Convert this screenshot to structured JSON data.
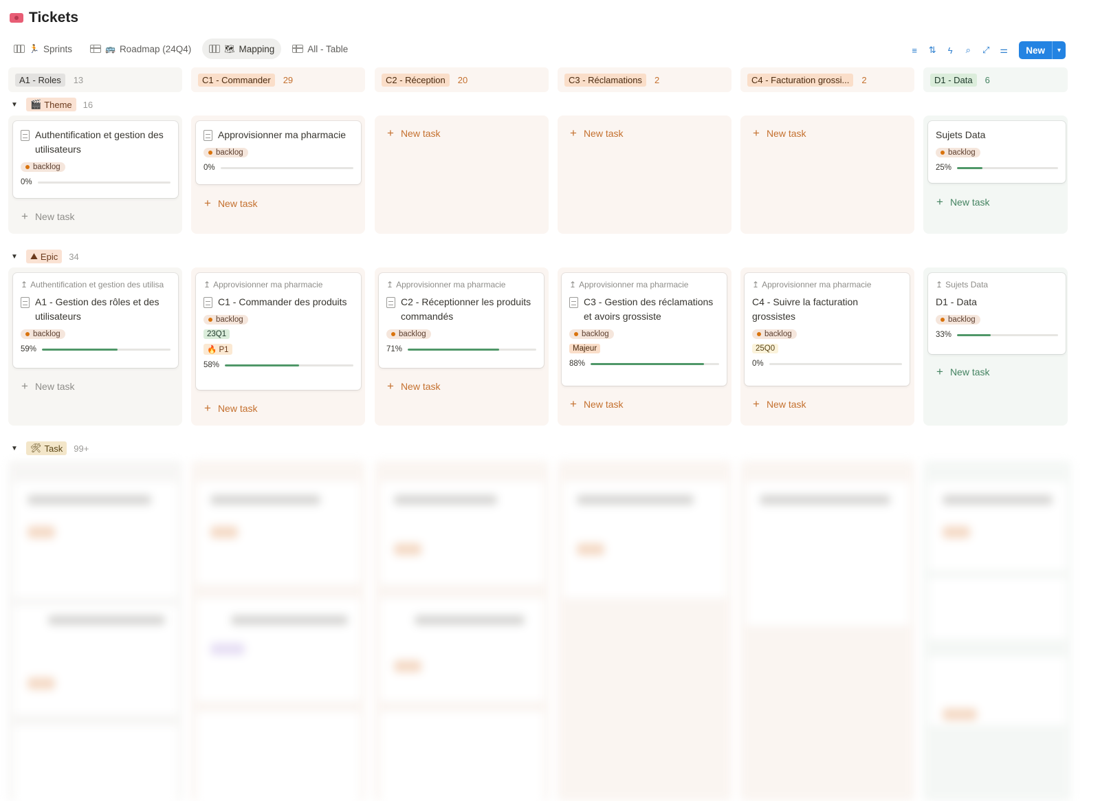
{
  "page": {
    "title": "Tickets",
    "icon": "ticket-icon"
  },
  "tabs": [
    {
      "label": "Sprints",
      "icon": "board-icon",
      "emoji": "🏃"
    },
    {
      "label": "Roadmap (24Q4)",
      "icon": "table-icon",
      "emoji": "🚌"
    },
    {
      "label": "Mapping",
      "icon": "board-icon",
      "emoji": "🗺",
      "active": true
    },
    {
      "label": "All - Table",
      "icon": "table-icon",
      "emoji": ""
    }
  ],
  "toolbar": {
    "icons": [
      "filter-icon",
      "sort-icon",
      "lightning-icon",
      "search-icon",
      "expand-icon",
      "settings-icon"
    ],
    "new_label": "New"
  },
  "columns": [
    {
      "label": "A1 - Roles",
      "count": "13",
      "color": "gray"
    },
    {
      "label": "C1 - Commander",
      "count": "29",
      "color": "orange"
    },
    {
      "label": "C2 - Réception",
      "count": "20",
      "color": "orange"
    },
    {
      "label": "C3 - Réclamations",
      "count": "2",
      "color": "orange"
    },
    {
      "label": "C4 - Facturation grossi...",
      "count": "2",
      "color": "orange"
    },
    {
      "label": "D1 - Data",
      "count": "6",
      "color": "green"
    }
  ],
  "groups": {
    "theme": {
      "label": "Theme",
      "emoji": "🎬",
      "count": "16"
    },
    "epic": {
      "label": "Epic",
      "emoji": "⛰",
      "count": "34"
    },
    "task": {
      "label": "Task",
      "emoji": "🛠",
      "count": "99+"
    }
  },
  "new_task_label": "New task",
  "theme_cards": [
    {
      "title": "Authentification et gestion des utilisateurs",
      "status": "backlog",
      "progress_label": "0%",
      "progress": 0
    },
    {
      "title": "Approvisionner ma pharmacie",
      "status": "backlog",
      "progress_label": "0%",
      "progress": 0
    },
    {
      "title": "Sujets Data",
      "status": "backlog",
      "progress_label": "25%",
      "progress": 0.25
    }
  ],
  "epic_cards": [
    {
      "parent": "Authentification et gestion des utilisa",
      "title": "A1 - Gestion des rôles et des utilisateurs",
      "status": "backlog",
      "progress_label": "59%",
      "progress": 0.59
    },
    {
      "parent": "Approvisionner ma pharmacie",
      "title": "C1 - Commander des produits",
      "status": "backlog",
      "tags": [
        "23Q1",
        "🔥 P1"
      ],
      "progress_label": "58%",
      "progress": 0.58
    },
    {
      "parent": "Approvisionner ma pharmacie",
      "title": "C2 - Réceptionner les produits commandés",
      "status": "backlog",
      "progress_label": "71%",
      "progress": 0.71
    },
    {
      "parent": "Approvisionner ma pharmacie",
      "title": "C3 - Gestion des réclamations et avoirs grossiste",
      "status": "backlog",
      "tags": [
        "Majeur"
      ],
      "progress_label": "88%",
      "progress": 0.88
    },
    {
      "parent": "Approvisionner ma pharmacie",
      "title": "C4 - Suivre la facturation grossistes",
      "status": "backlog",
      "tags": [
        "25Q0"
      ],
      "progress_label": "0%",
      "progress": 0
    },
    {
      "parent": "Sujets Data",
      "title": "D1 - Data",
      "status": "backlog",
      "progress_label": "33%",
      "progress": 0.33
    }
  ],
  "colors": {
    "accent": "#2383e2",
    "progress": "#4f9768",
    "status_dot": "#d9730d"
  }
}
